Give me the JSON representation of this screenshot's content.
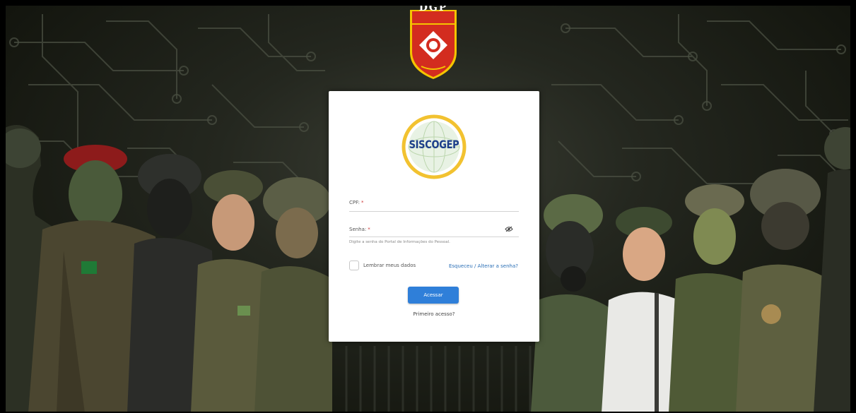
{
  "header": {
    "emblem_text": "DGP"
  },
  "login": {
    "logo_text": "SISCOGEP",
    "cpf": {
      "label": "CPF:",
      "required_mark": "*",
      "value": ""
    },
    "senha": {
      "label": "Senha:",
      "required_mark": "*",
      "value": "",
      "hint": "Digite a senha do Portal de Informações do Pessoal."
    },
    "remember_label": "Lembrar meus dados",
    "forgot_link": "Esqueceu / Alterar a senha?",
    "submit_label": "Acessar",
    "first_access_link": "Primeiro acesso?"
  },
  "colors": {
    "primary_button": "#2f7fd9",
    "link": "#2a6fb6",
    "logo_ring": "#f2c230",
    "emblem_red": "#d32c1f",
    "emblem_yellow": "#f4c400"
  },
  "icons": {
    "password_toggle": "eye-slash-icon"
  }
}
